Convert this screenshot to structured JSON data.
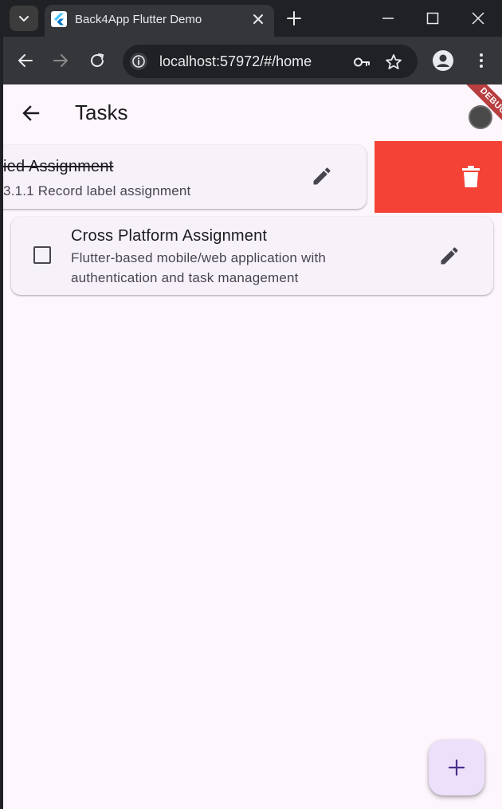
{
  "browser": {
    "tab_title": "Back4App Flutter Demo",
    "url": "localhost:57972/#/home"
  },
  "app": {
    "title": "Tasks",
    "debug_banner": "DEBUG"
  },
  "tasks": [
    {
      "title": "ied Assignment",
      "subtitle": "3.1.1 Record label assignment",
      "completed": true,
      "swiping_to_delete": true
    },
    {
      "title": "Cross Platform Assignment",
      "subtitle": "Flutter-based mobile/web application with authentication and task management",
      "completed": false,
      "swiping_to_delete": false
    }
  ],
  "colors": {
    "delete_background": "#f44336",
    "app_background": "#fdf7fd",
    "card_background": "#f7f2fa",
    "fab_background": "#ece0fb",
    "fab_icon": "#4a2d8a"
  },
  "icons": {
    "back": "arrow-back-icon",
    "edit": "pencil-icon",
    "delete": "trash-icon",
    "add": "plus-icon"
  }
}
